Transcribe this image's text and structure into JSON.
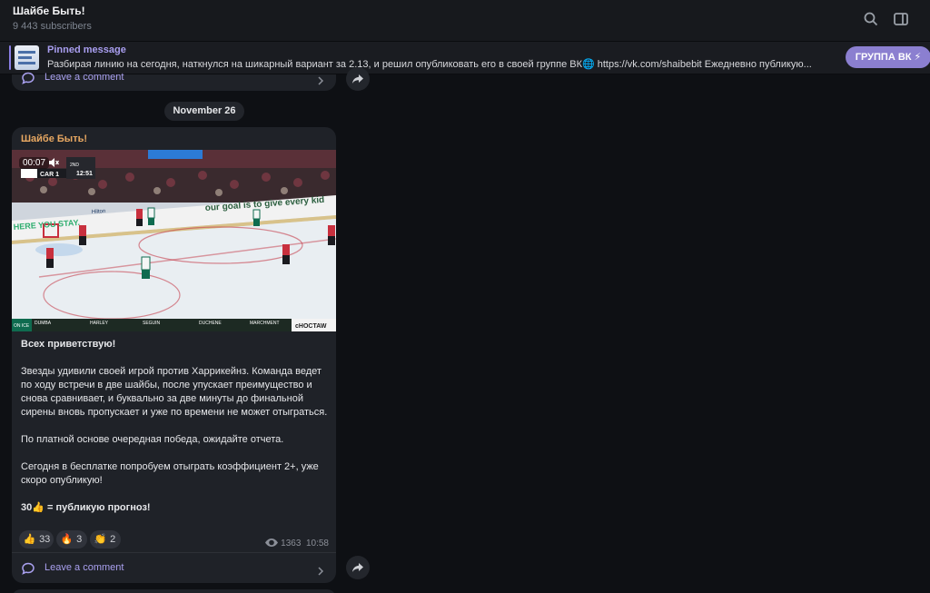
{
  "header": {
    "title": "Шайбе Быть!",
    "subscribers": "9 443 subscribers",
    "search_icon": "search-icon",
    "sidebar_icon": "sidebar-toggle-icon"
  },
  "pinned": {
    "label": "Pinned message",
    "text": "Разбирая линию на сегодня, наткнулся на шикарный вариант за 2.13, и решил опубликовать его в своей группе ВК🌐  https://vk.com/shaibebit  Ежедневно публикую...",
    "button_label": "ГРУППА ВК ⚡"
  },
  "previous_message": {
    "comment_label": "Leave a comment"
  },
  "date_separator": "November 26",
  "message": {
    "author": "Шайбе Быть!",
    "video_time": "00:07",
    "paragraphs": [
      "Всех приветствую!",
      "Звезды удивили своей игрой против Харрикейнз. Команда ведет по ходу встречи в две шайбы, после упускает преимущество и снова сравнивает, и буквально за две минуты до финальной сирены вновь пропускает и уже по времени не может отыграться.",
      "По платной основе очередная победа, ожидайте отчета.",
      "Сегодня в бесплатке попробуем отыграть коэффициент 2+, уже скоро опубликую!",
      "30👍 = публикую прогноз!"
    ],
    "reactions": [
      {
        "emoji": "👍",
        "count": "33"
      },
      {
        "emoji": "🔥",
        "count": "3"
      },
      {
        "emoji": "👏",
        "count": "2"
      }
    ],
    "views": "1363",
    "time": "10:58",
    "comment_label": "Leave a comment"
  },
  "video_overlay": {
    "team": "CAR 1",
    "period": "2ND",
    "clock": "12:51",
    "board_text": "our goal is to give every kid",
    "board_left": "HERE YOU STAY.",
    "sponsor": "Hilton",
    "lower_names": [
      "DUMBA",
      "HARLEY",
      "SEGUIN",
      "DUCHENE",
      "MARCHMENT"
    ],
    "lower_label": "ON ICE",
    "brand": "ᴄHOCTAW"
  },
  "colors": {
    "accent": "#8b7fe6",
    "author": "#e8a862",
    "bubble": "#1f2228",
    "background": "#0e1014"
  }
}
